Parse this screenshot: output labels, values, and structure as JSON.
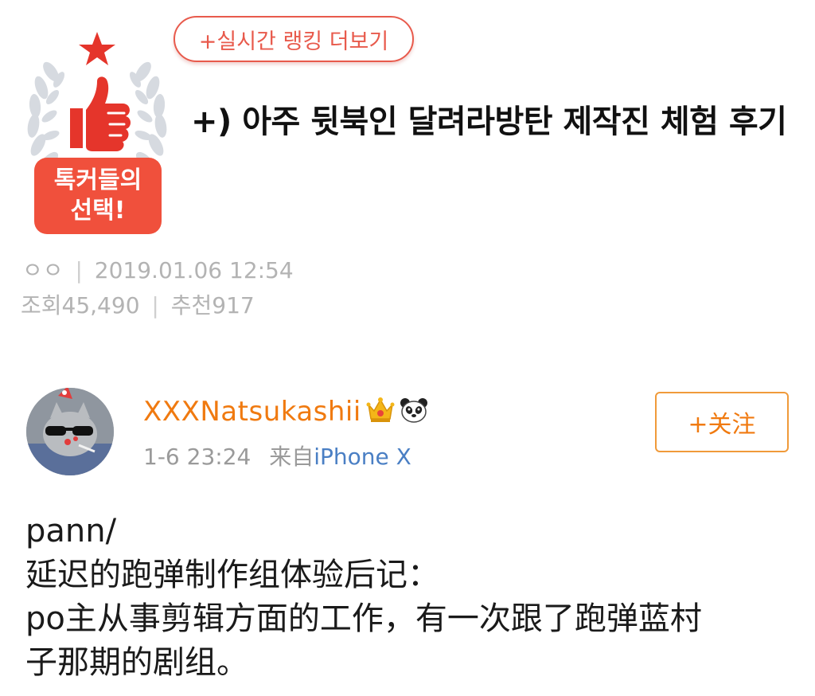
{
  "pann": {
    "badge_line1": "톡커들의",
    "badge_line2": "선택!",
    "realtime_ranking_label": "+실시간 랭킹 더보기",
    "title": "+) 아주 뒷북인 달려라방탄 제작진 체험 후기",
    "author": "ㅇㅇ",
    "date": "2019.01.06 12:54",
    "views_label": "조회",
    "views": "45,490",
    "likes_label": "추천",
    "likes": "917"
  },
  "weibo": {
    "username": "XXXNatsukashii",
    "time": "1-6 23:24",
    "source_prefix": "来自",
    "device": "iPhone X",
    "follow_label": "+关注",
    "body_lines": [
      "pann/",
      "延迟的跑弹制作组体验后记：",
      "po主从事剪辑方面的工作，有一次跟了跑弹蓝村",
      "子那期的剧组。"
    ]
  },
  "colors": {
    "accent_red": "#f0503c",
    "weibo_orange": "#f07a10",
    "device_blue": "#4a7fc4",
    "meta_gray": "#b3b3b3"
  },
  "icons": [
    "laurel-wreath-icon",
    "star-icon",
    "thumbs-up-icon",
    "crown-icon",
    "panda-icon"
  ]
}
